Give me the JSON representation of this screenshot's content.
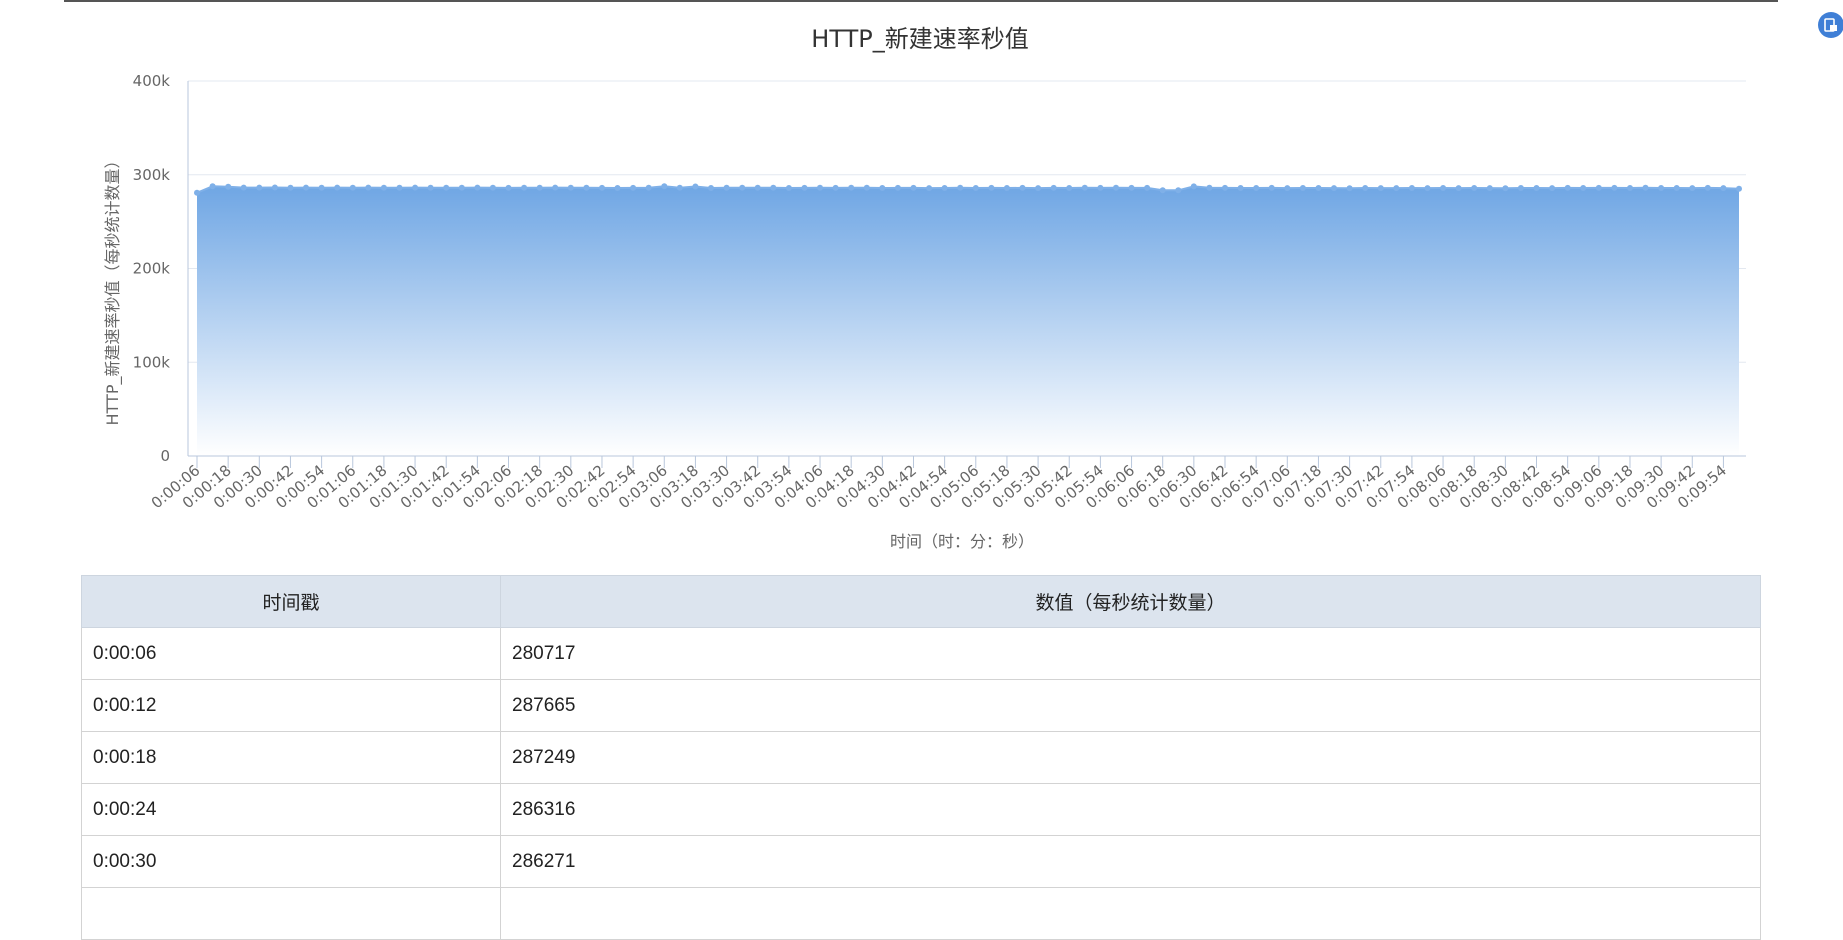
{
  "chart_data": {
    "type": "area",
    "title": "HTTP_新建速率秒值",
    "xlabel": "时间（时：分：秒）",
    "ylabel": "HTTP_新建速率秒值（每秒统计数量）",
    "ylim": [
      0,
      400000
    ],
    "y_tick_labels": [
      "0",
      "100k",
      "200k",
      "300k",
      "400k"
    ],
    "grid": true,
    "colors": {
      "line": "#7fb0e8",
      "fill_top": "#6fa6e4",
      "fill_bottom": "#ffffff",
      "grid": "#e3e8f0",
      "axis": "#b9c7dc"
    },
    "x": [
      "0:00:06",
      "0:00:12",
      "0:00:18",
      "0:00:24",
      "0:00:30",
      "0:00:36",
      "0:00:42",
      "0:00:48",
      "0:00:54",
      "0:01:00",
      "0:01:06",
      "0:01:12",
      "0:01:18",
      "0:01:24",
      "0:01:30",
      "0:01:36",
      "0:01:42",
      "0:01:48",
      "0:01:54",
      "0:02:00",
      "0:02:06",
      "0:02:12",
      "0:02:18",
      "0:02:24",
      "0:02:30",
      "0:02:36",
      "0:02:42",
      "0:02:48",
      "0:02:54",
      "0:03:00",
      "0:03:06",
      "0:03:12",
      "0:03:18",
      "0:03:24",
      "0:03:30",
      "0:03:36",
      "0:03:42",
      "0:03:48",
      "0:03:54",
      "0:04:00",
      "0:04:06",
      "0:04:12",
      "0:04:18",
      "0:04:24",
      "0:04:30",
      "0:04:36",
      "0:04:42",
      "0:04:48",
      "0:04:54",
      "0:05:00",
      "0:05:06",
      "0:05:12",
      "0:05:18",
      "0:05:24",
      "0:05:30",
      "0:05:36",
      "0:05:42",
      "0:05:48",
      "0:05:54",
      "0:06:00",
      "0:06:06",
      "0:06:12",
      "0:06:18",
      "0:06:24",
      "0:06:30",
      "0:06:36",
      "0:06:42",
      "0:06:48",
      "0:06:54",
      "0:07:00",
      "0:07:06",
      "0:07:12",
      "0:07:18",
      "0:07:24",
      "0:07:30",
      "0:07:36",
      "0:07:42",
      "0:07:48",
      "0:07:54",
      "0:08:00",
      "0:08:06",
      "0:08:12",
      "0:08:18",
      "0:08:24",
      "0:08:30",
      "0:08:36",
      "0:08:42",
      "0:08:48",
      "0:08:54",
      "0:09:00",
      "0:09:06",
      "0:09:12",
      "0:09:18",
      "0:09:24",
      "0:09:30",
      "0:09:36",
      "0:09:42",
      "0:09:48",
      "0:09:54",
      "0:10:00"
    ],
    "x_tick_labels": [
      "0:00:06",
      "0:00:18",
      "0:00:30",
      "0:00:42",
      "0:00:54",
      "0:01:06",
      "0:01:18",
      "0:01:30",
      "0:01:42",
      "0:01:54",
      "0:02:06",
      "0:02:18",
      "0:02:30",
      "0:02:42",
      "0:02:54",
      "0:03:06",
      "0:03:18",
      "0:03:30",
      "0:03:42",
      "0:03:54",
      "0:04:06",
      "0:04:18",
      "0:04:30",
      "0:04:42",
      "0:04:54",
      "0:05:06",
      "0:05:18",
      "0:05:30",
      "0:05:42",
      "0:05:54",
      "0:06:06",
      "0:06:18",
      "0:06:30",
      "0:06:42",
      "0:06:54",
      "0:07:06",
      "0:07:18",
      "0:07:30",
      "0:07:42",
      "0:07:54",
      "0:08:06",
      "0:08:18",
      "0:08:30",
      "0:08:42",
      "0:08:54",
      "0:09:06",
      "0:09:18",
      "0:09:30",
      "0:09:42",
      "0:09:54"
    ],
    "series": [
      {
        "values": [
          280717,
          287665,
          287249,
          286316,
          286271,
          286400,
          286200,
          286300,
          286100,
          286250,
          286150,
          286300,
          286200,
          286100,
          286250,
          286150,
          286200,
          286100,
          286300,
          286150,
          286000,
          286200,
          286100,
          286250,
          286050,
          286150,
          286000,
          285900,
          286000,
          286100,
          287800,
          286200,
          287500,
          285900,
          286100,
          286200,
          286050,
          286150,
          285900,
          286000,
          286100,
          285950,
          286050,
          286150,
          285900,
          286000,
          285950,
          285800,
          285900,
          286100,
          285900,
          286000,
          285850,
          285950,
          285800,
          286000,
          285900,
          286050,
          286000,
          286150,
          286000,
          285950,
          283500,
          283400,
          287600,
          286200,
          286000,
          285900,
          285850,
          285950,
          285800,
          285900,
          285850,
          285800,
          285700,
          285850,
          285800,
          285750,
          285900,
          285800,
          285850,
          285750,
          285900,
          285800,
          285700,
          285850,
          285900,
          285800,
          286000,
          285850,
          285950,
          286000,
          285900,
          286050,
          285850,
          285900,
          285800,
          285950,
          285750,
          285000
        ],
        "values_note_free": true
      }
    ]
  },
  "table": {
    "headers": [
      "时间戳",
      "数值（每秒统计数量）"
    ],
    "rows": [
      [
        "0:00:06",
        "280717"
      ],
      [
        "0:00:12",
        "287665"
      ],
      [
        "0:00:18",
        "287249"
      ],
      [
        "0:00:24",
        "286316"
      ],
      [
        "0:00:30",
        "286271"
      ]
    ]
  },
  "icons": {
    "floating_button": "export-icon"
  }
}
